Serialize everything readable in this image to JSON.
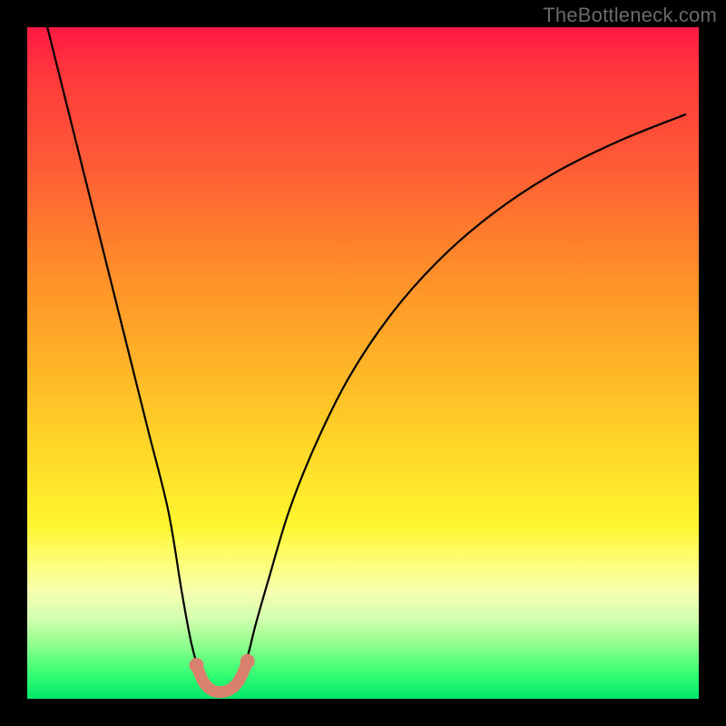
{
  "watermark": "TheBottleneck.com",
  "chart_data": {
    "type": "line",
    "title": "",
    "xlabel": "",
    "ylabel": "",
    "xlim": [
      0,
      100
    ],
    "ylim": [
      0,
      100
    ],
    "series": [
      {
        "name": "bottleneck-curve",
        "x": [
          3,
          6,
          9,
          12,
          15,
          18,
          21,
          23,
          24.5,
          26,
          27,
          28,
          29,
          30,
          31,
          32,
          33,
          34,
          36,
          39,
          43,
          48,
          54,
          61,
          69,
          78,
          88,
          98
        ],
        "y": [
          100,
          88,
          76,
          64,
          52,
          40,
          28,
          16,
          8,
          3,
          1.5,
          1,
          1,
          1.2,
          2,
          4,
          7,
          11,
          18,
          28,
          38,
          48,
          57,
          65,
          72,
          78,
          83,
          87
        ]
      }
    ],
    "markers": {
      "name": "bottleneck-band",
      "color": "#d9806f",
      "x": [
        25.2,
        26.2,
        27.3,
        28.5,
        29.8,
        31.0,
        32.0,
        32.8
      ],
      "y": [
        5.0,
        2.6,
        1.4,
        1.0,
        1.2,
        2.0,
        3.6,
        5.6
      ]
    }
  }
}
